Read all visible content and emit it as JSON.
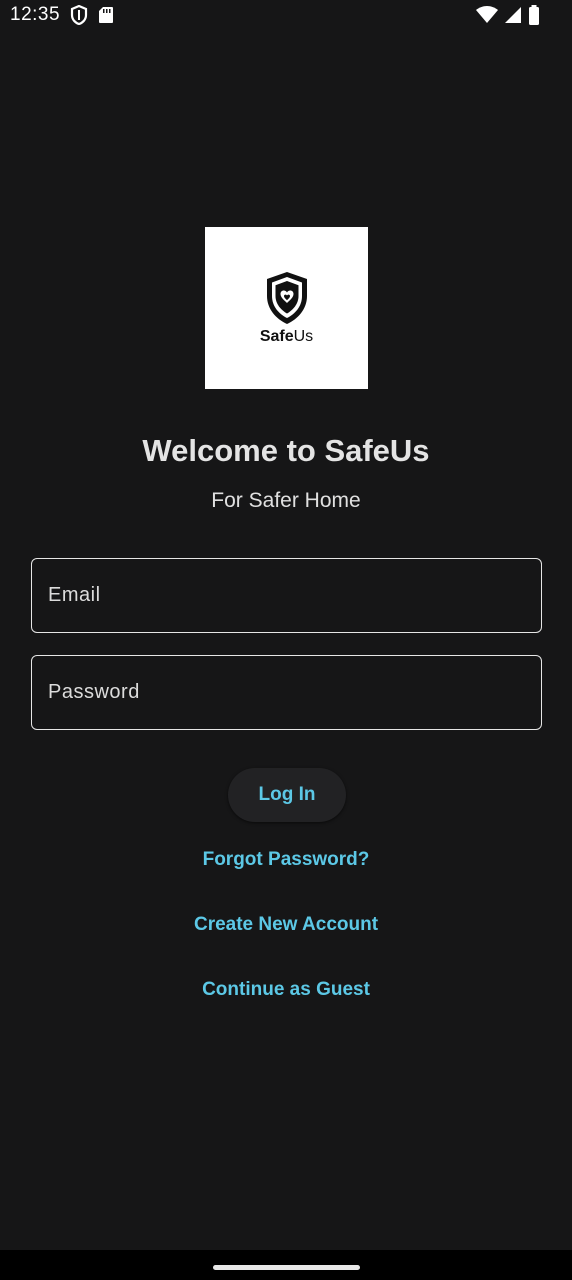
{
  "status_bar": {
    "time": "12:35",
    "left_icons": [
      "shield-icon",
      "sd-card-icon"
    ],
    "right_icons": [
      "wifi-icon",
      "signal-icon",
      "battery-icon"
    ]
  },
  "logo": {
    "brand_bold": "Safe",
    "brand_light": "Us"
  },
  "header": {
    "title": "Welcome to SafeUs",
    "subtitle": "For Safer Home"
  },
  "form": {
    "email_placeholder": "Email",
    "email_value": "",
    "password_placeholder": "Password",
    "password_value": ""
  },
  "actions": {
    "login_label": "Log In",
    "forgot_password_label": "Forgot Password?",
    "create_account_label": "Create New Account",
    "guest_label": "Continue as Guest"
  },
  "colors": {
    "background": "#161617",
    "accent": "#5cc8e6",
    "text": "#e6e6e6"
  }
}
